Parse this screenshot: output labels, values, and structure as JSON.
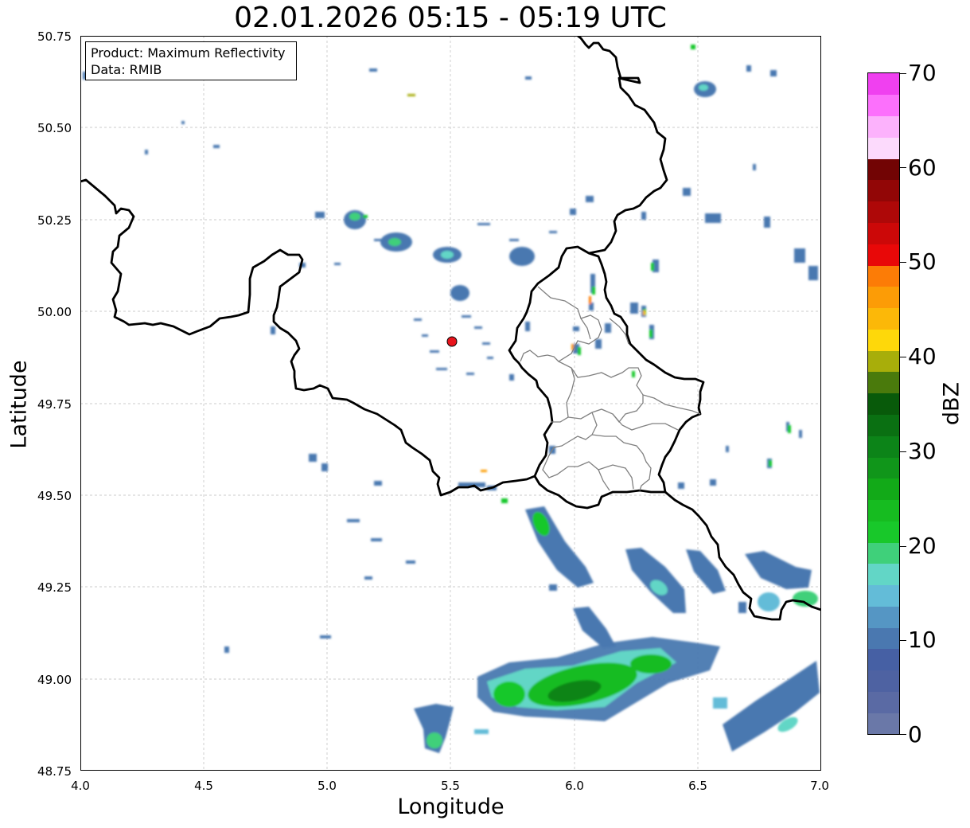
{
  "title": "02.01.2026 05:15 - 05:19 UTC",
  "info": {
    "product": "Product: Maximum Reflectivity",
    "source": "Data: RMIB"
  },
  "axes": {
    "xlabel": "Longitude",
    "ylabel": "Latitude",
    "xlim": [
      4.0,
      7.0
    ],
    "ylim": [
      48.75,
      50.75
    ],
    "xticks": [
      "4.0",
      "4.5",
      "5.0",
      "5.5",
      "6.0",
      "6.5",
      "7.0"
    ],
    "yticks": [
      "50.75",
      "50.50",
      "50.25",
      "50.00",
      "49.75",
      "49.50",
      "49.25",
      "49.00",
      "48.75"
    ],
    "grid": true
  },
  "radar_site": {
    "lon": 5.505,
    "lat": 49.915,
    "color": "#e8141c"
  },
  "colorbar": {
    "label": "dBZ",
    "range": [
      0,
      70
    ],
    "ticks": [
      "0",
      "10",
      "20",
      "30",
      "40",
      "50",
      "60",
      "70"
    ],
    "colors": [
      "#6a78a8",
      "#5a6aa4",
      "#4e62a2",
      "#4660a4",
      "#4a78b0",
      "#5596c4",
      "#63bcd8",
      "#62d6c6",
      "#3fd07a",
      "#18c82a",
      "#16bc20",
      "#12aa18",
      "#10961a",
      "#0c8418",
      "#0a7012",
      "#085a0a",
      "#4a7a0c",
      "#a8ae0a",
      "#fed80a",
      "#fcb808",
      "#fc9c06",
      "#fc7c06",
      "#e80808",
      "#cc0808",
      "#ae0808",
      "#920606",
      "#720404",
      "#fcdafc",
      "#fcb2fc",
      "#fc70fc",
      "#f040f0"
    ]
  },
  "chart_data": {
    "type": "heatmap",
    "title": "02.01.2026 05:15 - 05:19 UTC",
    "xlabel": "Longitude",
    "ylabel": "Latitude",
    "xlim": [
      4.0,
      7.0
    ],
    "ylim": [
      48.75,
      50.75
    ],
    "value_unit": "dBZ",
    "value_range": [
      0,
      70
    ],
    "echo_cells": [
      {
        "lon": 5.97,
        "lat": 48.96,
        "dbz": 30
      },
      {
        "lon": 6.1,
        "lat": 48.98,
        "dbz": 27
      },
      {
        "lon": 6.33,
        "lat": 49.04,
        "dbz": 22
      },
      {
        "lon": 5.75,
        "lat": 48.93,
        "dbz": 24
      },
      {
        "lon": 5.47,
        "lat": 48.85,
        "dbz": 22
      },
      {
        "lon": 5.86,
        "lat": 49.41,
        "dbz": 22
      },
      {
        "lon": 6.35,
        "lat": 49.24,
        "dbz": 18
      },
      {
        "lon": 6.82,
        "lat": 49.26,
        "dbz": 15
      },
      {
        "lon": 6.92,
        "lat": 49.22,
        "dbz": 20
      },
      {
        "lon": 6.95,
        "lat": 48.93,
        "dbz": 14
      },
      {
        "lon": 6.86,
        "lat": 48.88,
        "dbz": 22
      },
      {
        "lon": 5.13,
        "lat": 50.26,
        "dbz": 18
      },
      {
        "lon": 5.3,
        "lat": 50.18,
        "dbz": 17
      },
      {
        "lon": 5.48,
        "lat": 50.15,
        "dbz": 14
      },
      {
        "lon": 5.59,
        "lat": 50.06,
        "dbz": 12
      },
      {
        "lon": 5.75,
        "lat": 50.15,
        "dbz": 14
      },
      {
        "lon": 6.52,
        "lat": 50.62,
        "dbz": 14
      },
      {
        "lon": 6.23,
        "lat": 49.14,
        "dbz": 8
      },
      {
        "lon": 6.45,
        "lat": 49.31,
        "dbz": 8
      }
    ]
  }
}
